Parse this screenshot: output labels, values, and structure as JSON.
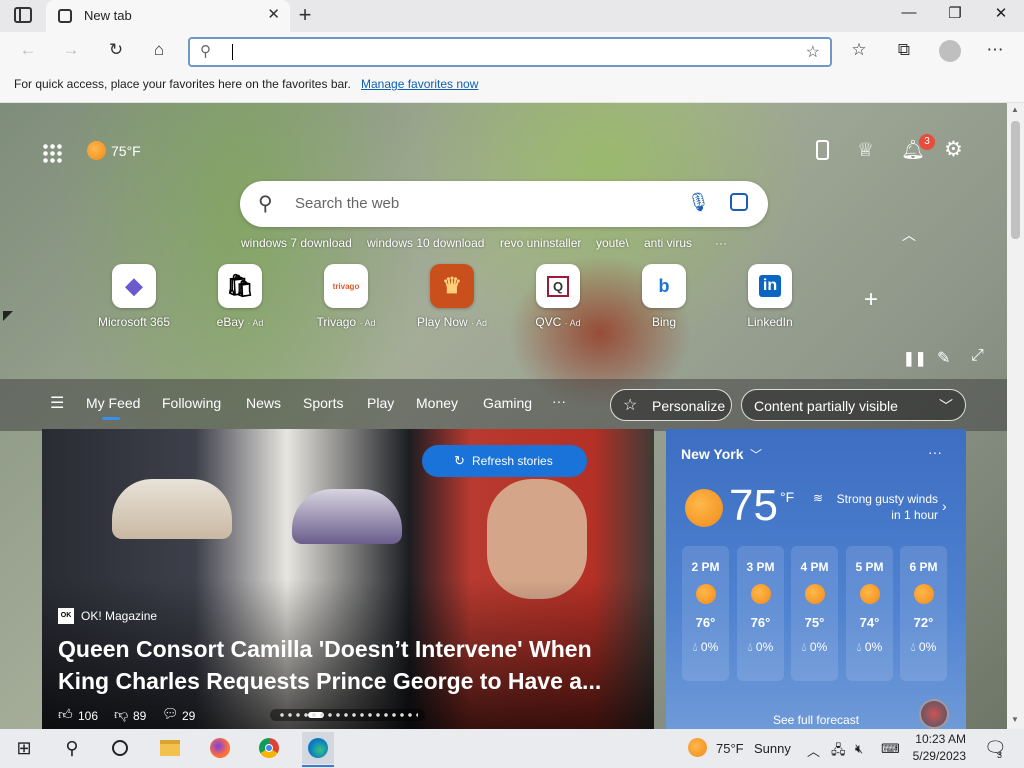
{
  "browser": {
    "tab_title": "New tab",
    "tab_close": "✕",
    "new_tab": "+",
    "win_minimize": "—",
    "win_restore": "❐",
    "win_close": "✕",
    "address_value": "",
    "favbar_text": "For quick access, place your favorites here on the favorites bar.",
    "favbar_link": "Manage favorites now"
  },
  "newtab": {
    "weather_temp": "75°F",
    "notifications_count": "3",
    "search_placeholder": "Search the web",
    "suggestions": [
      "windows 7 download",
      "windows 10 download",
      "revo uninstaller",
      "youte\\",
      "anti virus"
    ],
    "more": "···",
    "tiles": [
      {
        "label": "Microsoft 365",
        "ad": "",
        "glyph": "◆",
        "color": "#6a5acd"
      },
      {
        "label": "eBay",
        "ad": "· Ad",
        "glyph": "🛍",
        "color": "#e53238"
      },
      {
        "label": "Trivago",
        "ad": "· Ad",
        "glyph": "trivago",
        "color": "#e05b2c"
      },
      {
        "label": "Play Now",
        "ad": "· Ad",
        "glyph": "♛",
        "color": "#c9501c"
      },
      {
        "label": "QVC",
        "ad": "· Ad",
        "glyph": "Q",
        "color": "#a0183a"
      },
      {
        "label": "Bing",
        "ad": "",
        "glyph": "b",
        "color": "#1a73d9"
      },
      {
        "label": "LinkedIn",
        "ad": "",
        "glyph": "in",
        "color": "#0a66c2"
      }
    ],
    "add_tile": "+",
    "feed_tabs": [
      "My Feed",
      "Following",
      "News",
      "Sports",
      "Play",
      "Money",
      "Gaming"
    ],
    "feed_more": "···",
    "personalize": "Personalize",
    "content_visibility": "Content partially visible"
  },
  "hero": {
    "refresh_label": "Refresh stories",
    "source": "OK! Magazine",
    "source_badge": "OK",
    "headline_1": "Queen Consort Camilla 'Doesn’t Intervene' When",
    "headline_2": "King Charles Requests Prince George to Have a...",
    "likes": "106",
    "dislikes": "89",
    "comments": "29"
  },
  "weather": {
    "city": "New York",
    "temp": "75",
    "unit": "°F",
    "note_1": "Strong gusty winds",
    "note_2": "in 1 hour",
    "menu": "···",
    "hours": [
      {
        "time": "2 PM",
        "temp": "76°",
        "precip": "0%"
      },
      {
        "time": "3 PM",
        "temp": "76°",
        "precip": "0%"
      },
      {
        "time": "4 PM",
        "temp": "75°",
        "precip": "0%"
      },
      {
        "time": "5 PM",
        "temp": "74°",
        "precip": "0%"
      },
      {
        "time": "6 PM",
        "temp": "72°",
        "precip": "0%"
      }
    ],
    "forecast_link": "See full forecast"
  },
  "taskbar": {
    "weather": "75°F",
    "condition": "Sunny",
    "time": "10:23 AM",
    "date": "5/29/2023",
    "notif_count": "3"
  },
  "colors": {
    "accent": "#1a73d9",
    "sun": "#f59a23",
    "badge": "#e74c3c"
  }
}
